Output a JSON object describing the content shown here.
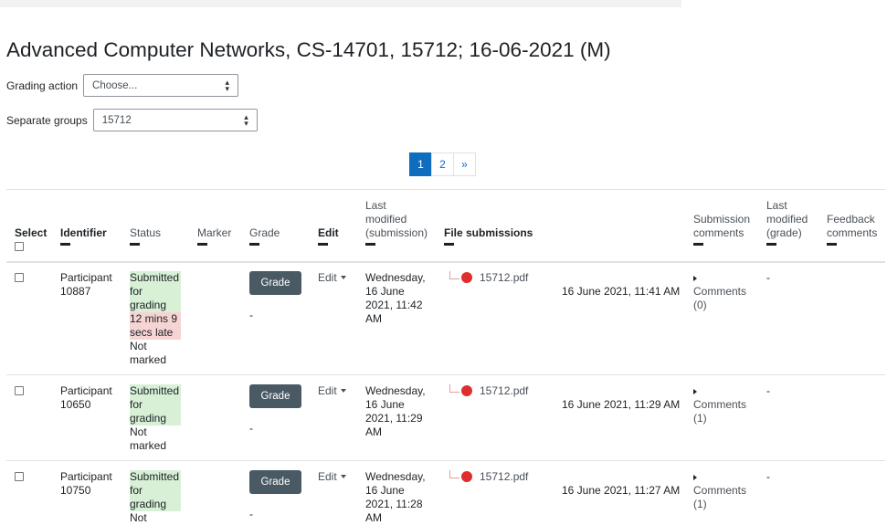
{
  "page": {
    "title": "Advanced Computer Networks, CS-14701, 15712; 16-06-2021 (M)"
  },
  "grading_action": {
    "label": "Grading action",
    "value": "Choose..."
  },
  "separate_groups": {
    "label": "Separate groups",
    "value": "15712"
  },
  "pagination": {
    "pages": [
      "1",
      "2"
    ],
    "current": "1",
    "next": "»"
  },
  "headers": {
    "select": "Select",
    "identifier": "Identifier",
    "status": "Status",
    "marker": "Marker",
    "grade": "Grade",
    "edit": "Edit",
    "last_modified_submission": [
      "Last",
      "modified",
      "(submission)"
    ],
    "file_submissions": "File submissions",
    "submission_comments": [
      "Submission",
      "comments"
    ],
    "last_modified_grade": [
      "Last",
      "modified",
      "(grade)"
    ],
    "feedback_comments": [
      "Feedback",
      "comments"
    ]
  },
  "rows": [
    {
      "identifier": [
        "Participant",
        "10887"
      ],
      "status_submitted": [
        "Submitted",
        "for",
        "grading"
      ],
      "status_late": [
        "12 mins 9",
        "secs late"
      ],
      "status_marked": [
        "Not",
        "marked"
      ],
      "grade_button": "Grade",
      "grade_value": "-",
      "edit": "Edit",
      "last_modified": [
        "Wednesday,",
        "16 June",
        "2021, 11:42",
        "AM"
      ],
      "file": "15712.pdf",
      "file_time": "16 June 2021, 11:41 AM",
      "comments": [
        "Comments",
        "(0)"
      ],
      "last_modified_grade": "-"
    },
    {
      "identifier": [
        "Participant",
        "10650"
      ],
      "status_submitted": [
        "Submitted",
        "for",
        "grading"
      ],
      "status_late": [],
      "status_marked": [
        "Not",
        "marked"
      ],
      "grade_button": "Grade",
      "grade_value": "-",
      "edit": "Edit",
      "last_modified": [
        "Wednesday,",
        "16 June",
        "2021, 11:29",
        "AM"
      ],
      "file": "15712.pdf",
      "file_time": "16 June 2021, 11:29 AM",
      "comments": [
        "Comments",
        "(1)"
      ],
      "last_modified_grade": "-"
    },
    {
      "identifier": [
        "Participant",
        "10750"
      ],
      "status_submitted": [
        "Submitted",
        "for",
        "grading"
      ],
      "status_late": [],
      "status_marked": [
        "Not"
      ],
      "grade_button": "Grade",
      "grade_value": "-",
      "edit": "Edit",
      "last_modified": [
        "Wednesday,",
        "16 June",
        "2021, 11:28",
        "AM"
      ],
      "file": "15712.pdf",
      "file_time": "16 June 2021, 11:27 AM",
      "comments": [
        "Comments",
        "(1)"
      ],
      "last_modified_grade": "-"
    }
  ]
}
